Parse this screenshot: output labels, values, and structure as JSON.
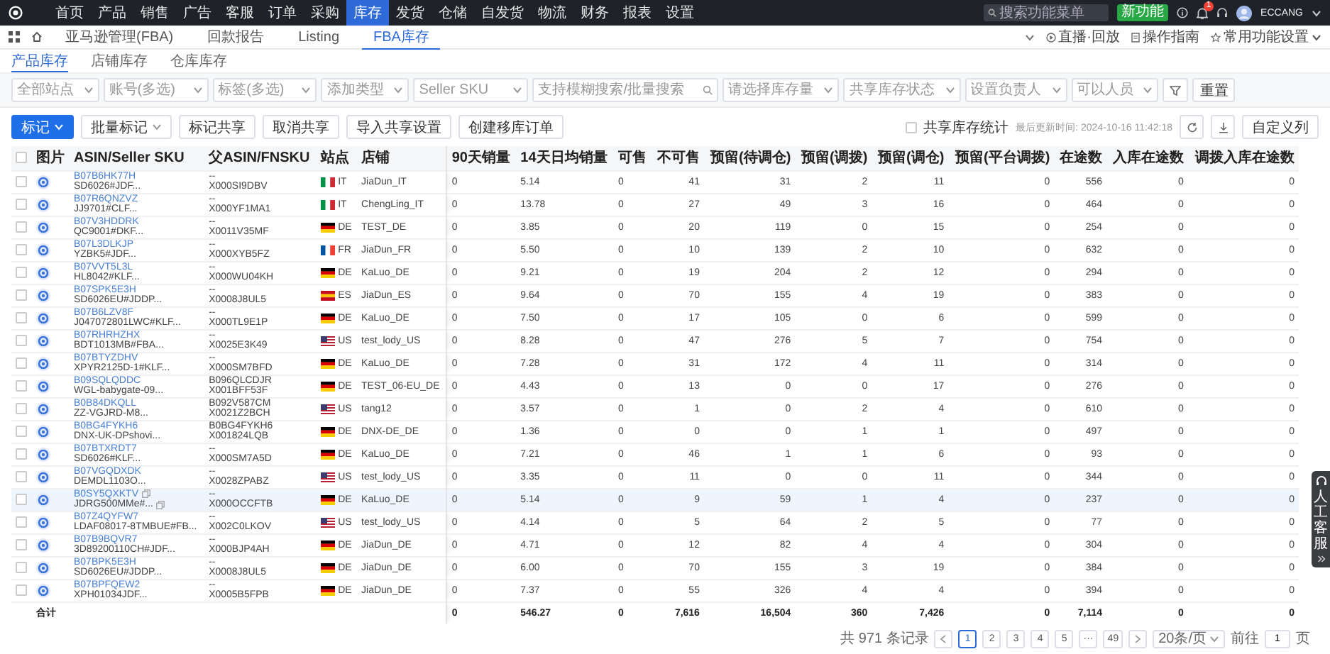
{
  "top_nav": {
    "items": [
      {
        "label": "首页",
        "selected": false
      },
      {
        "label": "产品",
        "selected": false
      },
      {
        "label": "销售",
        "selected": false
      },
      {
        "label": "广告",
        "selected": false
      },
      {
        "label": "客服",
        "selected": false
      },
      {
        "label": "订单",
        "selected": false
      },
      {
        "label": "采购",
        "selected": false
      },
      {
        "label": "库存",
        "selected": true
      },
      {
        "label": "发货",
        "selected": false
      },
      {
        "label": "仓储",
        "selected": false
      },
      {
        "label": "自发货",
        "selected": false
      },
      {
        "label": "物流",
        "selected": false
      },
      {
        "label": "财务",
        "selected": false
      },
      {
        "label": "报表",
        "selected": false
      },
      {
        "label": "设置",
        "selected": false
      }
    ]
  },
  "search": {
    "placeholder": "搜索功能菜单"
  },
  "new_feature_button": "新功能",
  "notification_badge": "1",
  "user": "ECCANG",
  "page_tabs": [
    {
      "label": "亚马逊管理(FBA)",
      "selected": false
    },
    {
      "label": "回款报告",
      "selected": false
    },
    {
      "label": "Listing",
      "selected": false
    },
    {
      "label": "FBA库存",
      "selected": true
    }
  ],
  "header_links": [
    {
      "kind": "live",
      "label": "直播·回放"
    },
    {
      "kind": "guide",
      "label": "操作指南"
    },
    {
      "kind": "settings",
      "label": "常用功能设置"
    }
  ],
  "sub_tabs": [
    {
      "label": "产品库存",
      "selected": true
    },
    {
      "label": "店铺库存",
      "selected": false
    },
    {
      "label": "仓库库存",
      "selected": false
    }
  ],
  "filters": [
    {
      "kind": "select",
      "placeholder": "全部站点"
    },
    {
      "kind": "select",
      "placeholder": "账号(多选)"
    },
    {
      "kind": "select",
      "placeholder": "标签(多选)"
    },
    {
      "kind": "select",
      "placeholder": "添加类型"
    },
    {
      "kind": "select",
      "placeholder": "Seller SKU"
    },
    {
      "kind": "search",
      "placeholder": "支持模糊搜索/批量搜索"
    },
    {
      "kind": "select",
      "placeholder": "请选择库存量"
    },
    {
      "kind": "select",
      "placeholder": "共享库存状态"
    },
    {
      "kind": "select",
      "placeholder": "设置负责人"
    },
    {
      "kind": "select",
      "placeholder": "可以人员"
    }
  ],
  "reset_button": "重置",
  "actions": [
    {
      "kind": "primary",
      "label": "标记"
    },
    {
      "kind": "dropdown",
      "label": "批量标记"
    },
    {
      "kind": "plain",
      "label": "标记共享"
    },
    {
      "kind": "plain",
      "label": "取消共享"
    },
    {
      "kind": "plain",
      "label": "导入共享设置"
    },
    {
      "kind": "plain",
      "label": "创建移库订单"
    }
  ],
  "share_stats": {
    "label": "共享库存统计",
    "checked": false
  },
  "last_updated": "最后更新时间: 2024-10-16 11:42:18",
  "customize_columns": "自定义列",
  "table": {
    "select_all_checked": false,
    "columns": [
      "图片",
      "ASIN/Seller SKU",
      "父ASIN/FNSKU",
      "站点",
      "店铺",
      "90天销量",
      "14天日均销量",
      "可售",
      "不可售",
      "预留(待调仓)",
      "预留(调拨)",
      "预留(调仓)",
      "预留(平台调拨)",
      "在途数",
      "入库在途数",
      "调拨入库在途数"
    ],
    "rows": [
      {
        "checked": false,
        "highlighted": false,
        "asin": "B07B6HK77H",
        "seller_sku": "SD6026#JDF...",
        "parent_asin": "--",
        "fnsku": "X000SI9DBV",
        "site": "IT",
        "store": "JiaDun_IT",
        "values": [
          "0",
          "5.14",
          "0",
          "41",
          "31",
          "2",
          "11",
          "0",
          "556",
          "0",
          "0"
        ]
      },
      {
        "checked": false,
        "highlighted": false,
        "asin": "B07R6QNZVZ",
        "seller_sku": "JJ9701#CLF...",
        "parent_asin": "--",
        "fnsku": "X000YF1MA1",
        "site": "IT",
        "store": "ChengLing_IT",
        "values": [
          "0",
          "13.78",
          "0",
          "27",
          "49",
          "3",
          "16",
          "0",
          "464",
          "0",
          "0"
        ]
      },
      {
        "checked": false,
        "highlighted": false,
        "asin": "B07V3HDDRK",
        "seller_sku": "QC9001#DKF...",
        "parent_asin": "--",
        "fnsku": "X0011V35MF",
        "site": "DE",
        "store": "TEST_DE",
        "values": [
          "0",
          "3.85",
          "0",
          "20",
          "119",
          "0",
          "15",
          "0",
          "254",
          "0",
          "0"
        ]
      },
      {
        "checked": false,
        "highlighted": false,
        "asin": "B07L3DLKJP",
        "seller_sku": "YZBK5#JDF...",
        "parent_asin": "--",
        "fnsku": "X000XYB5FZ",
        "site": "FR",
        "store": "JiaDun_FR",
        "values": [
          "0",
          "5.50",
          "0",
          "10",
          "139",
          "2",
          "10",
          "0",
          "632",
          "0",
          "0"
        ]
      },
      {
        "checked": false,
        "highlighted": false,
        "asin": "B07VVT5L3L",
        "seller_sku": "HL8042#KLF...",
        "parent_asin": "--",
        "fnsku": "X000WU04KH",
        "site": "DE",
        "store": "KaLuo_DE",
        "values": [
          "0",
          "9.21",
          "0",
          "19",
          "204",
          "2",
          "12",
          "0",
          "294",
          "0",
          "0"
        ]
      },
      {
        "checked": false,
        "highlighted": false,
        "asin": "B07SPK5E3H",
        "seller_sku": "SD6026EU#JDDP...",
        "parent_asin": "--",
        "fnsku": "X0008J8UL5",
        "site": "ES",
        "store": "JiaDun_ES",
        "values": [
          "0",
          "9.64",
          "0",
          "70",
          "155",
          "4",
          "19",
          "0",
          "383",
          "0",
          "0"
        ]
      },
      {
        "checked": false,
        "highlighted": false,
        "asin": "B07B6LZV8F",
        "seller_sku": "J047072801LWC#KLF...",
        "parent_asin": "--",
        "fnsku": "X000TL9E1P",
        "site": "DE",
        "store": "KaLuo_DE",
        "values": [
          "0",
          "7.50",
          "0",
          "17",
          "105",
          "0",
          "6",
          "0",
          "599",
          "0",
          "0"
        ]
      },
      {
        "checked": false,
        "highlighted": false,
        "asin": "B07RHRHZHX",
        "seller_sku": "BDT1013MB#FBA...",
        "parent_asin": "--",
        "fnsku": "X0025E3K49",
        "site": "US",
        "store": "test_lody_US",
        "values": [
          "0",
          "8.28",
          "0",
          "47",
          "276",
          "5",
          "7",
          "0",
          "754",
          "0",
          "0"
        ]
      },
      {
        "checked": false,
        "highlighted": false,
        "asin": "B07BTYZDHV",
        "seller_sku": "XPYR2125D-1#KLF...",
        "parent_asin": "--",
        "fnsku": "X000SM7BFD",
        "site": "DE",
        "store": "KaLuo_DE",
        "values": [
          "0",
          "7.28",
          "0",
          "31",
          "172",
          "4",
          "11",
          "0",
          "314",
          "0",
          "0"
        ]
      },
      {
        "checked": false,
        "highlighted": false,
        "asin": "B09SQLQDDC",
        "seller_sku": "WGL-babygate-09...",
        "parent_asin": "B096QLCDJR",
        "fnsku": "X001BFF53F",
        "site": "DE",
        "store": "TEST_06-EU_DE",
        "values": [
          "0",
          "4.43",
          "0",
          "13",
          "0",
          "0",
          "17",
          "0",
          "276",
          "0",
          "0"
        ]
      },
      {
        "checked": false,
        "highlighted": false,
        "asin": "B0B84DKQLL",
        "seller_sku": "ZZ-VGJRD-M8...",
        "parent_asin": "B092V587CM",
        "fnsku": "X0021Z2BCH",
        "site": "US",
        "store": "tang12",
        "values": [
          "0",
          "3.57",
          "0",
          "1",
          "0",
          "2",
          "4",
          "0",
          "610",
          "0",
          "0"
        ]
      },
      {
        "checked": false,
        "highlighted": false,
        "asin": "B0BG4FYKH6",
        "seller_sku": "DNX-UK-DPshovi...",
        "parent_asin": "B0BG4FYKH6",
        "fnsku": "X001824LQB",
        "site": "DE",
        "store": "DNX-DE_DE",
        "values": [
          "0",
          "1.36",
          "0",
          "0",
          "0",
          "1",
          "1",
          "0",
          "497",
          "0",
          "0"
        ]
      },
      {
        "checked": false,
        "highlighted": false,
        "asin": "B07BTXRDT7",
        "seller_sku": "SD6026#KLF...",
        "parent_asin": "--",
        "fnsku": "X000SM7A5D",
        "site": "DE",
        "store": "KaLuo_DE",
        "values": [
          "0",
          "7.21",
          "0",
          "46",
          "1",
          "1",
          "6",
          "0",
          "93",
          "0",
          "0"
        ]
      },
      {
        "checked": false,
        "highlighted": false,
        "asin": "B07VGQDXDK",
        "seller_sku": "DEMDL1103O...",
        "parent_asin": "--",
        "fnsku": "X0028ZPABZ",
        "site": "US",
        "store": "test_lody_US",
        "values": [
          "0",
          "3.35",
          "0",
          "11",
          "0",
          "0",
          "11",
          "0",
          "344",
          "0",
          "0"
        ]
      },
      {
        "checked": false,
        "highlighted": true,
        "asin": "B0SY5QXKTV",
        "seller_sku": "JDRG500MMe#...",
        "parent_asin": "--",
        "fnsku": "X000OCCFTB",
        "site": "DE",
        "store": "KaLuo_DE",
        "values": [
          "0",
          "5.14",
          "0",
          "9",
          "59",
          "1",
          "4",
          "0",
          "237",
          "0",
          "0"
        ]
      },
      {
        "checked": false,
        "highlighted": false,
        "asin": "B07Z4QYFW7",
        "seller_sku": "LDAF08017-8TMBUE#FB...",
        "parent_asin": "--",
        "fnsku": "X002C0LKOV",
        "site": "US",
        "store": "test_lody_US",
        "values": [
          "0",
          "4.14",
          "0",
          "5",
          "64",
          "2",
          "5",
          "0",
          "77",
          "0",
          "0"
        ]
      },
      {
        "checked": false,
        "highlighted": false,
        "asin": "B07B9BQVR7",
        "seller_sku": "3D89200110CH#JDF...",
        "parent_asin": "--",
        "fnsku": "X000BJP4AH",
        "site": "DE",
        "store": "JiaDun_DE",
        "values": [
          "0",
          "4.71",
          "0",
          "12",
          "82",
          "4",
          "4",
          "0",
          "304",
          "0",
          "0"
        ]
      },
      {
        "checked": false,
        "highlighted": false,
        "asin": "B07BPK5E3H",
        "seller_sku": "SD6026EU#JDDP...",
        "parent_asin": "--",
        "fnsku": "X0008J8UL5",
        "site": "DE",
        "store": "JiaDun_DE",
        "values": [
          "0",
          "6.00",
          "0",
          "70",
          "155",
          "3",
          "19",
          "0",
          "384",
          "0",
          "0"
        ]
      },
      {
        "checked": false,
        "highlighted": false,
        "asin": "B07BPFQEW2",
        "seller_sku": "XPH01034JDF...",
        "parent_asin": "--",
        "fnsku": "X0005B5FPB",
        "site": "DE",
        "store": "JiaDun_DE",
        "values": [
          "0",
          "7.37",
          "0",
          "55",
          "326",
          "4",
          "4",
          "0",
          "394",
          "0",
          "0"
        ]
      }
    ],
    "total": {
      "label": "合计",
      "values": [
        "0",
        "546.27",
        "0",
        "7,616",
        "16,504",
        "360",
        "7,426",
        "0",
        "7,114",
        "0",
        "0"
      ]
    }
  },
  "pagination": {
    "total": "共 971 条记录",
    "pages": [
      {
        "label": "1",
        "selected": true
      },
      {
        "label": "2",
        "selected": false
      },
      {
        "label": "3",
        "selected": false
      },
      {
        "label": "4",
        "selected": false
      },
      {
        "label": "5",
        "selected": false
      },
      {
        "label": "···",
        "selected": false
      },
      {
        "label": "49",
        "selected": false
      }
    ],
    "page_size": "20条/页",
    "goto_label": "前往",
    "goto_value": "1",
    "page_unit": "页"
  },
  "help_widget": {
    "label": "人工客服"
  }
}
